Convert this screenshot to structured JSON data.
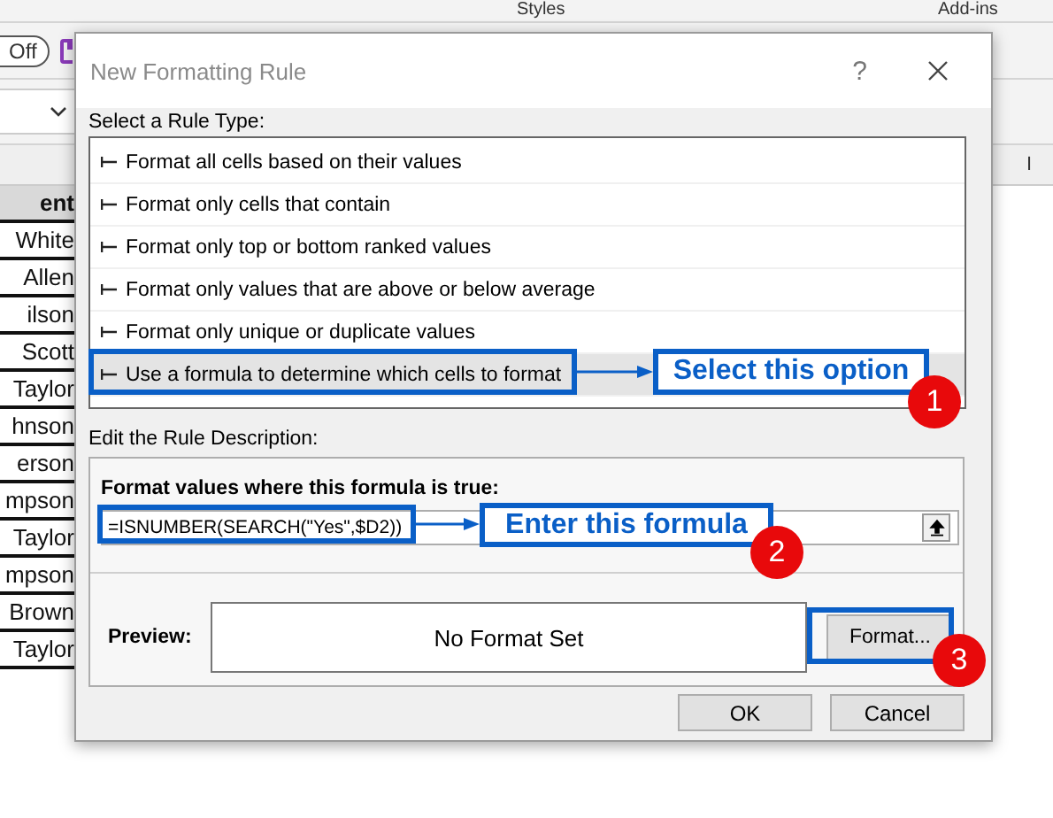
{
  "ribbon": {
    "group_labels": [
      "Styles",
      "Add-ins"
    ]
  },
  "toolbar": {
    "toggle": {
      "label": "Off",
      "on": false
    }
  },
  "sheet": {
    "column_header": "I",
    "name_header": "ent",
    "names": [
      "White",
      "Allen",
      "ilson",
      "Scott",
      "Taylor",
      "hnson",
      "erson",
      "mpson",
      "Taylor",
      "mpson",
      "Brown",
      "Taylor"
    ]
  },
  "dialog": {
    "title": "New Formatting Rule",
    "help": "?",
    "rule_type_label": "Select a Rule Type:",
    "rule_types": [
      {
        "label": "Format all cells based on their values",
        "selected": false
      },
      {
        "label": "Format only cells that contain",
        "selected": false
      },
      {
        "label": "Format only top or bottom ranked values",
        "selected": false
      },
      {
        "label": "Format only values that are above or below average",
        "selected": false
      },
      {
        "label": "Format only unique or duplicate values",
        "selected": false
      },
      {
        "label": "Use a formula to determine which cells to format",
        "selected": true
      }
    ],
    "description_label": "Edit the Rule Description:",
    "formula_label": "Format values where this formula is true:",
    "formula_value": "=ISNUMBER(SEARCH(\"Yes\",$D2))",
    "preview_label": "Preview:",
    "preview_text": "No Format Set",
    "format_button": "Format...",
    "buttons": [
      "OK",
      "Cancel"
    ]
  },
  "annotations": [
    {
      "text": "Select this option",
      "step": "1"
    },
    {
      "text": "Enter this formula",
      "step": "2"
    },
    {
      "step": "3"
    }
  ]
}
